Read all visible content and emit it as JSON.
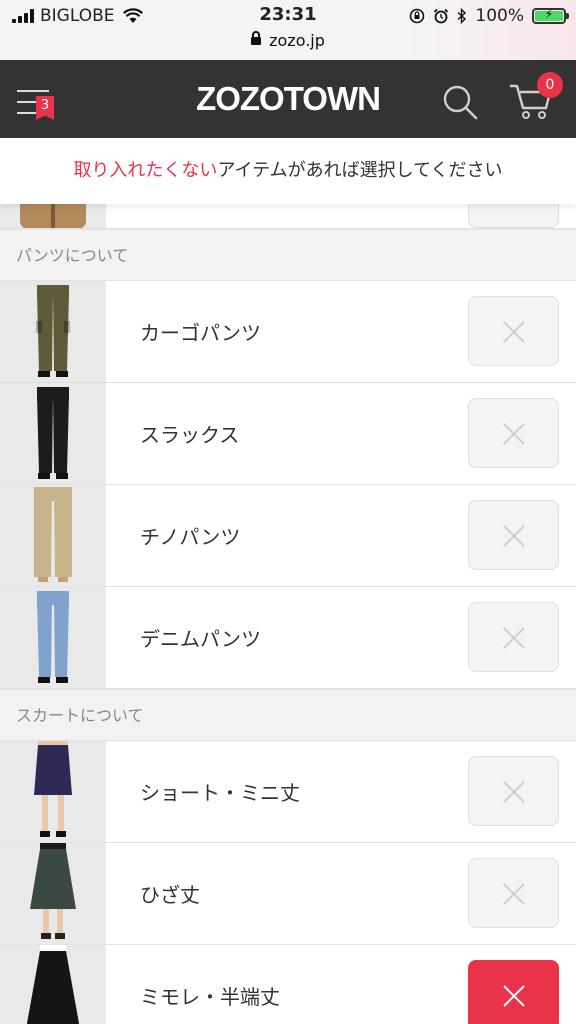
{
  "status": {
    "carrier": "BIGLOBE",
    "time": "23:31",
    "battery": "100%",
    "url": "zozo.jp"
  },
  "header": {
    "logo": "ZOZOTOWN",
    "menu_badge": "3",
    "cart_count": "0"
  },
  "notice": {
    "highlight": "取り入れたくない",
    "rest": "アイテムがあれば選択してください"
  },
  "sections": [
    {
      "title": "パンツについて",
      "items": [
        {
          "label": "カーゴパンツ",
          "selected": false,
          "garment": "cargo",
          "color": "#5f5a3a"
        },
        {
          "label": "スラックス",
          "selected": false,
          "garment": "slacks",
          "color": "#1c1c1c"
        },
        {
          "label": "チノパンツ",
          "selected": false,
          "garment": "chino",
          "color": "#c8b48a"
        },
        {
          "label": "デニムパンツ",
          "selected": false,
          "garment": "denim",
          "color": "#7fa3cc"
        }
      ]
    },
    {
      "title": "スカートについて",
      "items": [
        {
          "label": "ショート・ミニ丈",
          "selected": false,
          "garment": "mini",
          "color": "#2e2a55"
        },
        {
          "label": "ひざ丈",
          "selected": false,
          "garment": "knee",
          "color": "#3a4a42"
        },
        {
          "label": "ミモレ・半端丈",
          "selected": true,
          "garment": "midi",
          "color": "#151515"
        }
      ]
    }
  ],
  "colors": {
    "accent": "#e8334a",
    "header_bg": "#333333"
  }
}
